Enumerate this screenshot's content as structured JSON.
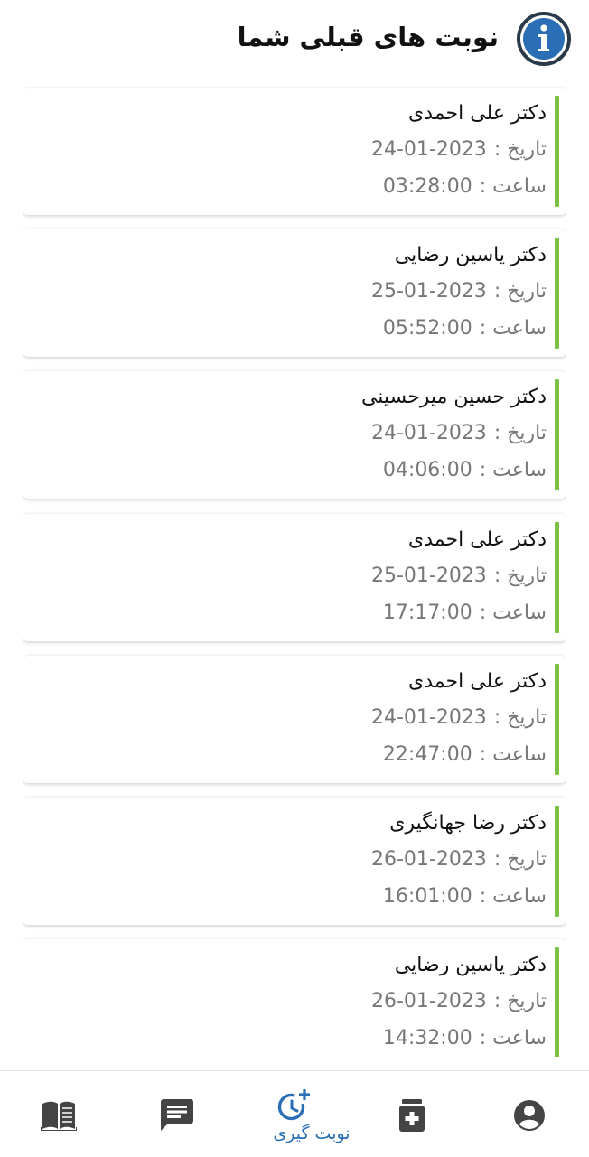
{
  "header": {
    "title": "نوبت های قبلی شما",
    "info_icon": "info-icon"
  },
  "colors": {
    "accent_green": "#7bc043",
    "active_blue": "#2a6fb5",
    "icon_gray": "#444444",
    "info_blue": "#2a6fb5"
  },
  "labels": {
    "date": "تاریخ :",
    "time": "ساعت :"
  },
  "appointments": [
    {
      "doctor": "دکتر علی احمدی",
      "date": "24-01-2023",
      "time": "03:28:00"
    },
    {
      "doctor": "دکتر یاسین رضایی",
      "date": "25-01-2023",
      "time": "05:52:00"
    },
    {
      "doctor": "دکتر حسین میرحسینی",
      "date": "24-01-2023",
      "time": "04:06:00"
    },
    {
      "doctor": "دکتر علی احمدی",
      "date": "25-01-2023",
      "time": "17:17:00"
    },
    {
      "doctor": "دکتر علی احمدی",
      "date": "24-01-2023",
      "time": "22:47:00"
    },
    {
      "doctor": "دکتر رضا جهانگیری",
      "date": "26-01-2023",
      "time": "16:01:00"
    },
    {
      "doctor": "دکتر یاسین رضایی",
      "date": "26-01-2023",
      "time": "14:32:00"
    }
  ],
  "bottom_nav": {
    "items": [
      {
        "icon": "book-icon",
        "label": ""
      },
      {
        "icon": "chat-icon",
        "label": ""
      },
      {
        "icon": "clock-plus-icon",
        "label": "نوبت گیری",
        "active": true
      },
      {
        "icon": "medicine-icon",
        "label": ""
      },
      {
        "icon": "account-icon",
        "label": ""
      }
    ]
  }
}
